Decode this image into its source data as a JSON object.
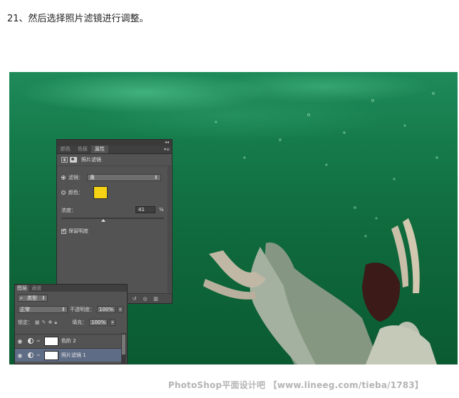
{
  "step_heading": "21、然后选择照片滤镜进行调整。",
  "properties_panel": {
    "tabs": [
      {
        "label": "颜色",
        "active": false
      },
      {
        "label": "色板",
        "active": false
      },
      {
        "label": "属性",
        "active": true
      }
    ],
    "title": "照片滤镜",
    "filter": {
      "label": "滤镜：",
      "value": "黄",
      "selected": true
    },
    "color": {
      "label": "颜色：",
      "selected": false,
      "swatch_hex": "#f5d214"
    },
    "density": {
      "label": "浓度：",
      "value": "41",
      "unit": "%",
      "fraction": 0.41
    },
    "preserve_luminosity": {
      "label": "保留明度",
      "checked": true
    },
    "footer_icons": [
      "clip-to-layer-icon",
      "view-previous-icon",
      "reset-icon",
      "visibility-icon",
      "delete-icon"
    ]
  },
  "layers_panel": {
    "tabs": [
      {
        "label": "图层",
        "active": true
      },
      {
        "label": "通道",
        "active": false
      }
    ],
    "kind_filter": "类型",
    "blend_mode": "正常",
    "opacity_label": "不透明度：",
    "opacity_value": "100%",
    "lock_label": "锁定：",
    "fill_label": "填充：",
    "fill_value": "100%",
    "layers": [
      {
        "name": "色阶 2",
        "selected": false
      },
      {
        "name": "照片滤镜 1",
        "selected": true
      }
    ]
  },
  "watermark": "PhotoShop平面设计吧 【www.lineeg.com/tieba/1783】",
  "colors": {
    "panel_bg": "#535353",
    "selected_layer": "#5f6c86",
    "water": "#157a4a"
  }
}
